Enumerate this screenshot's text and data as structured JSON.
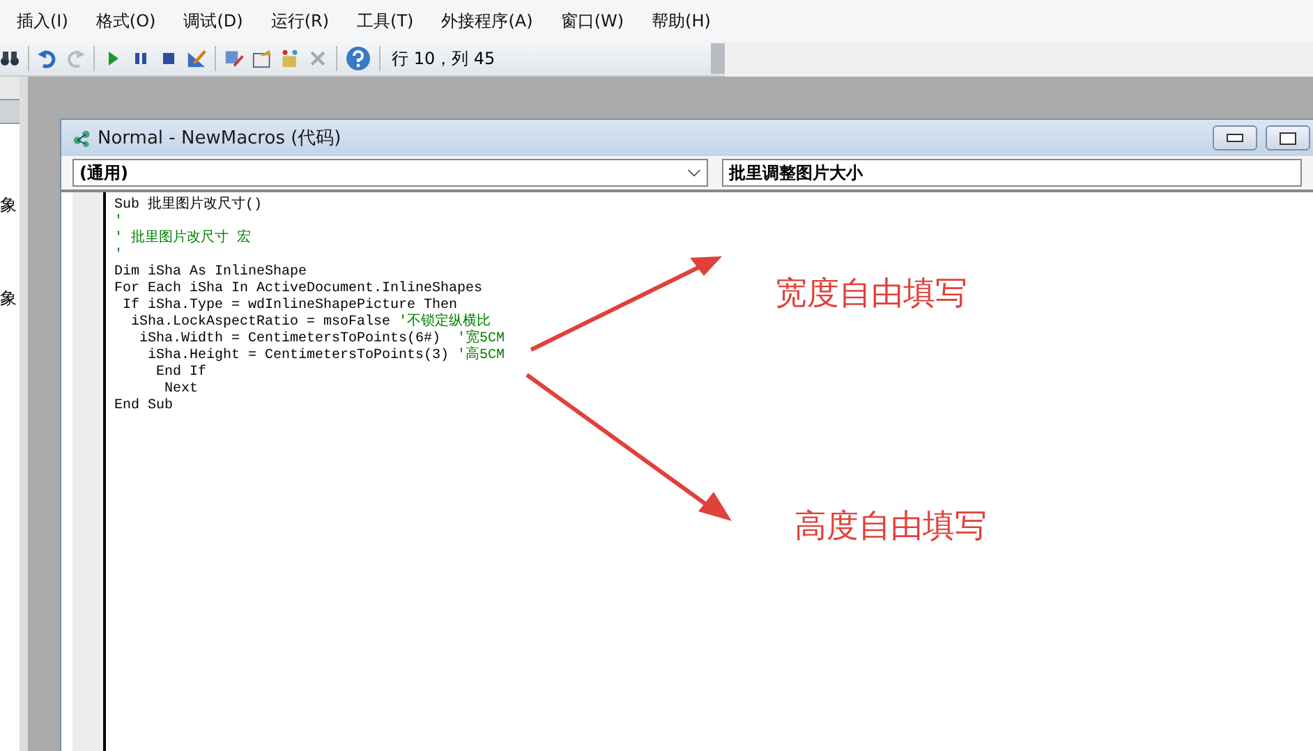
{
  "menu": [
    "插入(I)",
    "格式(O)",
    "调试(D)",
    "运行(R)",
    "工具(T)",
    "外接程序(A)",
    "窗口(W)",
    "帮助(H)"
  ],
  "toolbar": {
    "position": "行 10，列 45"
  },
  "side_panel": {
    "items": [
      "象",
      "象"
    ]
  },
  "code_window": {
    "title": "Normal - NewMacros (代码)",
    "object_dropdown": "(通用)",
    "procedure_dropdown": "批里调整图片大小",
    "lines": [
      {
        "code": "Sub 批里图片改尺寸()"
      },
      {
        "comment": "'"
      },
      {
        "comment": "' 批里图片改尺寸 宏"
      },
      {
        "comment": "'"
      },
      {
        "code": "Dim iSha As InlineShape"
      },
      {
        "code": "For Each iSha In ActiveDocument.InlineShapes"
      },
      {
        "code": " If iSha.Type = wdInlineShapePicture Then"
      },
      {
        "code": "  iSha.LockAspectRatio = msoFalse ",
        "comment": "'不锁定纵横比"
      },
      {
        "code": "   iSha.Width = CentimetersToPoints(6#)  ",
        "comment": "'宽5CM"
      },
      {
        "code": "    iSha.Height = CentimetersToPoints(3) ",
        "comment": "'高5CM"
      },
      {
        "code": "     End If"
      },
      {
        "code": "      Next"
      },
      {
        "code": "End Sub"
      }
    ]
  },
  "annotations": [
    "宽度自由填写",
    "高度自由填写"
  ]
}
